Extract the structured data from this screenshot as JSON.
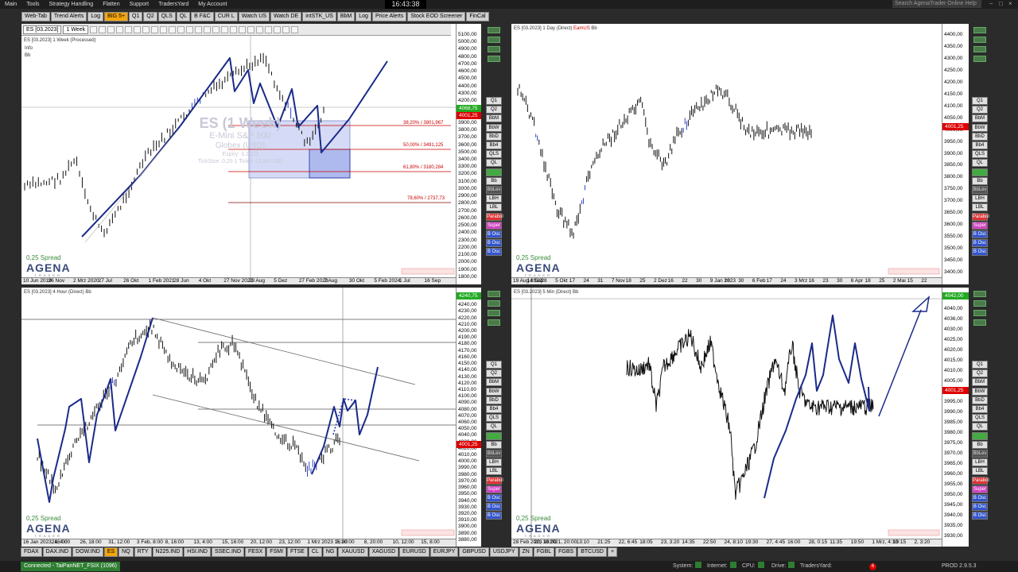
{
  "menu": {
    "items": [
      "Main",
      "Tools",
      "Strategy Handling",
      "Flatten",
      "Support",
      "TradersYard",
      "My Account"
    ],
    "clock": "16:43:38",
    "search_placeholder": "Search AgenaTrader Online Help"
  },
  "tabs": [
    {
      "label": "Web-Tab",
      "active": false
    },
    {
      "label": "Trend Alerts",
      "active": false
    },
    {
      "label": "Log",
      "active": false
    },
    {
      "label": "BIG 5+",
      "active": true
    },
    {
      "label": "Q1",
      "active": false
    },
    {
      "label": "Q2",
      "active": false
    },
    {
      "label": "QLS",
      "active": false
    },
    {
      "label": "QL",
      "active": false
    },
    {
      "label": "B F&C",
      "active": false
    },
    {
      "label": "CUR L",
      "active": false
    },
    {
      "label": "Watch US",
      "active": false
    },
    {
      "label": "Watch DE",
      "active": false
    },
    {
      "label": "intSTK_US",
      "active": false
    },
    {
      "label": "BbM",
      "active": false
    },
    {
      "label": "Log",
      "active": false
    },
    {
      "label": "Price Alerts",
      "active": false
    },
    {
      "label": "Stock EOD Screener",
      "active": false
    },
    {
      "label": "FinCal",
      "active": false
    }
  ],
  "toolbar": {
    "symbol": "ES [03.2023]",
    "timeframe": "1 Week"
  },
  "side_buttons": [
    "Q1",
    "Q2",
    "BbM",
    "BbW",
    "BbD",
    "Bb4",
    "QLS",
    "QL",
    "",
    "Bb",
    "BbLev",
    "LBH",
    "LBL",
    "Parabol",
    "Super",
    "B Osc",
    "B Osc",
    "B Osc"
  ],
  "panels": {
    "tl": {
      "header": "ES [03.2023]  1 Week (Processed)",
      "sub1": "Info",
      "sub2": "Bb",
      "y_labels": [
        "5100,00",
        "5000,00",
        "4900,00",
        "4800,00",
        "4700,00",
        "4600,00",
        "4500,00",
        "4400,00",
        "4300,00",
        "4200,00",
        "4100,00",
        "4000,00",
        "3900,00",
        "3800,00",
        "3700,00",
        "3600,00",
        "3500,00",
        "3400,00",
        "3300,00",
        "3200,00",
        "3100,00",
        "3000,00",
        "2900,00",
        "2800,00",
        "2700,00",
        "2600,00",
        "2500,00",
        "2400,00",
        "2300,00",
        "2200,00",
        "2100,00",
        "2000,00",
        "1900,00",
        "1800,00"
      ],
      "x_labels": [
        "10 Jun 2019",
        "26 Nov",
        "2 Mrz 2020",
        "27 Jul",
        "26 Okt",
        "1 Feb 2021",
        "28 Jun",
        "4 Okt",
        "27 Nov 2022",
        "29 Aug",
        "5 Dez",
        "27 Feb 2023",
        "7 Aug",
        "30 Okt",
        "5 Feb 2024",
        "1 Jul",
        "16 Sep"
      ],
      "price_tag": "4001,25",
      "price_tag2": "4068,75",
      "spread": "0,25 Spread",
      "watermark": {
        "title": "ES (1 Week)",
        "name": "E-Mini S&P 500",
        "exchange": "Globex  (USD)",
        "expiry": "Expiry: 3.2023",
        "tick": "TickSize: 0,25  1 Tick = 12,50 USD"
      },
      "fibs": [
        "38,20% / 3801,967",
        "50,00% / 3491,125",
        "61,80% / 3180,284",
        "78,60% / 2737,73"
      ]
    },
    "tr": {
      "header": "ES [03.2023]  1 Day (Direct)",
      "header_red": "EamUS",
      "header_tail": "Bb",
      "y_labels": [
        "4400,00",
        "4350,00",
        "4300,00",
        "4250,00",
        "4200,00",
        "4150,00",
        "4100,00",
        "4050,00",
        "4000,00",
        "3950,00",
        "3900,00",
        "3850,00",
        "3800,00",
        "3750,00",
        "3700,00",
        "3650,00",
        "3600,00",
        "3550,00",
        "3500,00",
        "3450,00",
        "3400,00"
      ],
      "x_labels": [
        "19 Aug 2022",
        "14 Sep",
        "28",
        "5 Okt",
        "17",
        "24",
        "31",
        "7 Nov",
        "18",
        "25",
        "2 Dez",
        "16",
        "22",
        "30",
        "9 Jan 2023",
        "18",
        "30",
        "6 Feb",
        "17",
        "24",
        "3 Mrz",
        "16",
        "23",
        "30",
        "6 Apr",
        "18",
        "25",
        "2 Mai",
        "15",
        "22"
      ],
      "price_tag": "4001,25",
      "spread": "0,25 Spread"
    },
    "bl": {
      "header": "ES [03.2023]  4 Hour (Direct)   Bb",
      "y_labels": [
        "4250,00",
        "4240,00",
        "4230,00",
        "4220,00",
        "4210,00",
        "4200,00",
        "4190,00",
        "4180,00",
        "4170,00",
        "4160,00",
        "4150,00",
        "4140,00",
        "4130,00",
        "4120,00",
        "4110,00",
        "4100,00",
        "4090,00",
        "4080,00",
        "4070,00",
        "4060,00",
        "4050,00",
        "4040,00",
        "4030,00",
        "4020,00",
        "4010,00",
        "4000,00",
        "3990,00",
        "3980,00",
        "3970,00",
        "3960,00",
        "3950,00",
        "3940,00",
        "3930,00",
        "3920,00",
        "3910,00",
        "3900,00",
        "3890,00",
        "3880,00"
      ],
      "x_labels": [
        "16 Jan 2023, 16:00",
        "24, 4:00",
        "26, 18:00",
        "31, 12:00",
        "3 Feb, 8:00",
        "8, 16:00",
        "13, 4:00",
        "15, 16:00",
        "20, 12:00",
        "23, 12:00",
        "1 Mrz 2023 16:00",
        "3, 20:00",
        "8, 20:00",
        "10, 12:00",
        "15, 8:00"
      ],
      "price_tag": "4001,25",
      "price_tag2": "4240,75",
      "spread": "0,25 Spread"
    },
    "br": {
      "header": "ES [03.2023]  5 Min (Direct)   Bb",
      "y_labels": [
        "4050,00",
        "4040,00",
        "4036,00",
        "4030,00",
        "4025,00",
        "4020,00",
        "4015,00",
        "4010,00",
        "4005,00",
        "4000,00",
        "3995,00",
        "3990,00",
        "3985,00",
        "3980,00",
        "3975,00",
        "3970,00",
        "3965,00",
        "3960,00",
        "3955,00",
        "3950,00",
        "3945,00",
        "3940,00",
        "3935,00",
        "3930,00"
      ],
      "x_labels": [
        "28 Feb 2023 18:00",
        "20, 10:20",
        "21, 20:00",
        "13:10",
        "21:25",
        "22, 6:45",
        "18:05",
        "23, 3:20",
        "14:35",
        "22:50",
        "24, 8:10",
        "19:30",
        "27, 4:45",
        "16:00",
        "28, 0:15",
        "11:35",
        "19:50",
        "1 Mrz, 4:10",
        "19:15",
        "2, 3:20"
      ],
      "price_tag": "4001,25",
      "price_tag2": "4042,00",
      "spread": "0,25 Spread"
    }
  },
  "logo": {
    "name": "AGENA",
    "tagline": "TRADER"
  },
  "bottom_tabs": [
    {
      "label": "FDAX",
      "active": false
    },
    {
      "label": "DAX.IND",
      "active": false
    },
    {
      "label": "DOW.IND",
      "active": false
    },
    {
      "label": "ES",
      "active": true
    },
    {
      "label": "NQ",
      "active": false
    },
    {
      "label": "RTY",
      "active": false
    },
    {
      "label": "N225.IND",
      "active": false
    },
    {
      "label": "HSI.IND",
      "active": false
    },
    {
      "label": "SSEC.IND",
      "active": false
    },
    {
      "label": "FESX",
      "active": false
    },
    {
      "label": "FSMI",
      "active": false
    },
    {
      "label": "FTSE",
      "active": false
    },
    {
      "label": "CL",
      "active": false
    },
    {
      "label": "NG",
      "active": false
    },
    {
      "label": "XAUUSD",
      "active": false
    },
    {
      "label": "XAGUSD",
      "active": false
    },
    {
      "label": "EURUSD",
      "active": false
    },
    {
      "label": "EURJPY",
      "active": false
    },
    {
      "label": "GBPUSD",
      "active": false
    },
    {
      "label": "USDJPY",
      "active": false
    },
    {
      "label": "ZN",
      "active": false
    },
    {
      "label": "FGBL",
      "active": false
    },
    {
      "label": "FGBS",
      "active": false
    },
    {
      "label": "BTCUSD",
      "active": false
    },
    {
      "label": "+",
      "active": false
    }
  ],
  "status": {
    "connection": "Connected - TaiPanNET_FSIX (1096)",
    "system": "System:",
    "internet": "Internet:",
    "cpu": "CPU:",
    "drive": "Drive:",
    "tradersyard": "TradersYard:",
    "badge": "6",
    "version": "PROD 2.9.5.3"
  },
  "colors": {
    "accent": "#f4a60b",
    "price_red": "#dd0000",
    "price_green": "#22aa22",
    "draw_blue": "#1a2a8a",
    "candle_blue": "#3344cc"
  }
}
